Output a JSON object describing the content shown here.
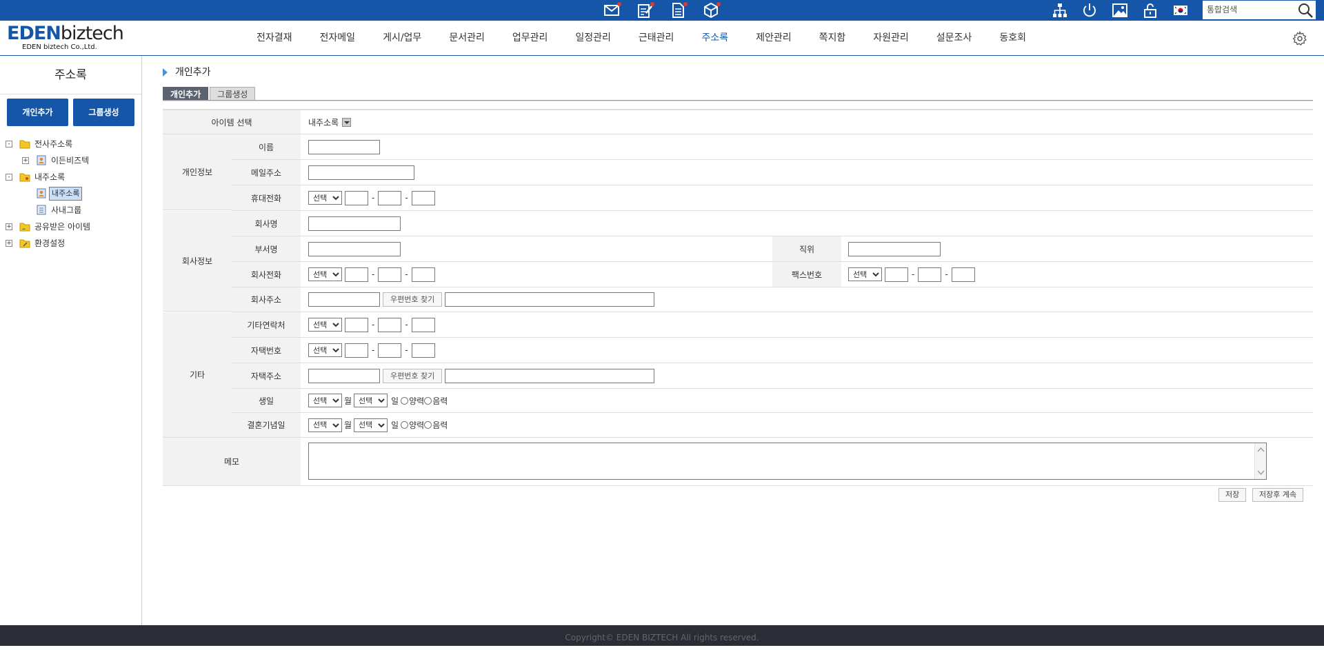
{
  "topbar": {
    "icons": [
      "mail-icon",
      "approval-icon",
      "document-icon",
      "cube-icon",
      "org-chart-icon",
      "power-icon",
      "image-icon",
      "lock-icon",
      "korea-flag-icon"
    ],
    "search_placeholder": "통합검색",
    "accent": "#1656a8"
  },
  "logo": {
    "main_a": "EDEN",
    "main_b": "biztech",
    "sub": "EDEN biztech Co.,Ltd."
  },
  "gnb": {
    "items": [
      "전자결재",
      "전자메일",
      "게시/업무",
      "문서관리",
      "업무관리",
      "일정관리",
      "근태관리",
      "주소록",
      "제안관리",
      "쪽지함",
      "자원관리",
      "설문조사",
      "동호회"
    ],
    "active": "주소록"
  },
  "sidebar": {
    "title": "주소록",
    "buttons": [
      "개인추가",
      "그룹생성"
    ],
    "tree": [
      {
        "label": "전사주소록",
        "toggle": "-"
      },
      {
        "label": "이든비즈텍",
        "toggle": "+"
      },
      {
        "label": "내주소록",
        "toggle": "-"
      },
      {
        "label": "내주소록",
        "selected": true
      },
      {
        "label": "사내그룹"
      },
      {
        "label": "공유받은 아이템",
        "toggle": "+"
      },
      {
        "label": "환경설정",
        "toggle": "+"
      }
    ]
  },
  "main": {
    "page_title": "개인추가",
    "tabs": [
      "개인추가",
      "그룹생성"
    ],
    "form": {
      "item_select_label": "아이템 선택",
      "item_select_value": "내주소록",
      "group_personal": "개인정보",
      "group_company": "회사정보",
      "group_etc": "기타",
      "name": "이름",
      "email": "메일주소",
      "mobile": "휴대전화",
      "company": "회사명",
      "dept": "부서명",
      "position": "직위",
      "company_phone": "회사전화",
      "fax": "팩스번호",
      "company_addr": "회사주소",
      "other_contact": "기타연락처",
      "home_phone": "자택번호",
      "home_addr": "자택주소",
      "birthday": "생일",
      "anniversary": "결혼기념일",
      "memo": "메모",
      "select_default": "선택",
      "dash": "-",
      "zip_button": "우편번호 찾기",
      "month": "월",
      "day": "일",
      "solar": "양력",
      "lunar": "음력"
    },
    "buttons": {
      "save": "저장",
      "save_continue": "저장후 계속"
    }
  },
  "footer": {
    "copyright": "Copyright© EDEN BIZTECH All rights reserved."
  }
}
